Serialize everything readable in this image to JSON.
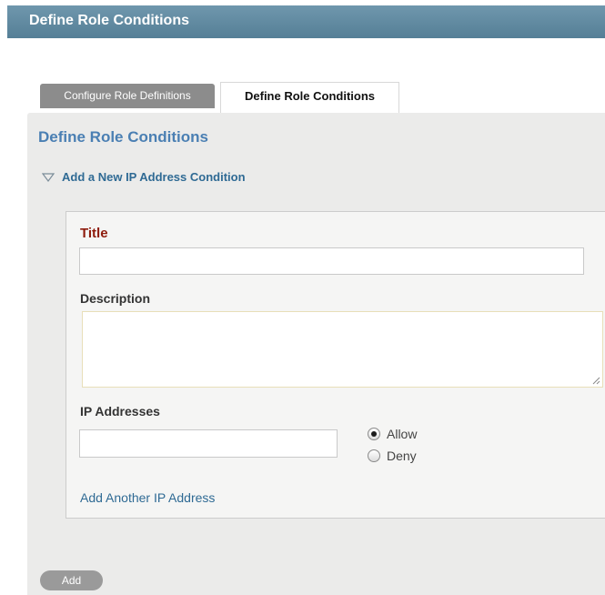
{
  "header": {
    "title": "Define Role Conditions"
  },
  "tabs": [
    {
      "label": "Configure Role Definitions",
      "active": false
    },
    {
      "label": "Define Role Conditions",
      "active": true
    }
  ],
  "section": {
    "title": "Define Role Conditions"
  },
  "expander": {
    "label": "Add a New IP Address Condition",
    "icon": "triangle-down-icon"
  },
  "form": {
    "title_label": "Title",
    "title_value": "",
    "description_label": "Description",
    "description_value": "",
    "ip_label": "IP Addresses",
    "ip_value": "",
    "radio_allow": "Allow",
    "radio_deny": "Deny",
    "selected": "Allow",
    "add_another_link": "Add Another IP Address"
  },
  "actions": {
    "add_label": "Add"
  },
  "colors": {
    "header": "#6b93a9",
    "title_label": "#8e1b0c",
    "section_title": "#4a7fb3",
    "link": "#2f6a94"
  }
}
